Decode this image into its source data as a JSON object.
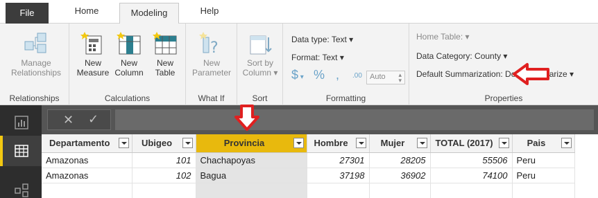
{
  "tabs": {
    "file": "File",
    "home": "Home",
    "modeling": "Modeling",
    "help": "Help"
  },
  "ribbon": {
    "relationships": {
      "manage_line1": "Manage",
      "manage_line2": "Relationships",
      "group_label": "Relationships"
    },
    "calculations": {
      "new_measure_line1": "New",
      "new_measure_line2": "Measure",
      "new_column_line1": "New",
      "new_column_line2": "Column",
      "new_table_line1": "New",
      "new_table_line2": "Table",
      "group_label": "Calculations"
    },
    "whatif": {
      "new_parameter_line1": "New",
      "new_parameter_line2": "Parameter",
      "group_label": "What If"
    },
    "sort": {
      "sort_by_line1": "Sort by",
      "sort_by_line2": "Column",
      "group_label": "Sort"
    },
    "formatting": {
      "data_type": "Data type: Text",
      "format": "Format: Text",
      "currency_symbol": "$",
      "percent_symbol": "%",
      "comma_symbol": ",",
      "decimal_symbol": ".00",
      "auto_value": "Auto",
      "group_label": "Formatting"
    },
    "properties": {
      "home_table": "Home Table:",
      "data_category": "Data Category: County",
      "default_summarization": "Default Summarization: Don't summarize",
      "group_label": "Properties"
    }
  },
  "grid": {
    "columns": [
      "Departamento",
      "Ubigeo",
      "Provincia",
      "Hombre",
      "Mujer",
      "TOTAL (2017)",
      "Pais"
    ],
    "rows": [
      [
        "Amazonas",
        "101",
        "Chachapoyas",
        "27301",
        "28205",
        "55506",
        "Peru"
      ],
      [
        "Amazonas",
        "102",
        "Bagua",
        "37198",
        "36902",
        "74100",
        "Peru"
      ]
    ]
  },
  "colors": {
    "highlight_column": "#e8b90d",
    "annotation_red": "#e02020",
    "dark_chrome": "#2d2d2d",
    "ribbon_bg": "#f3f3f3"
  }
}
